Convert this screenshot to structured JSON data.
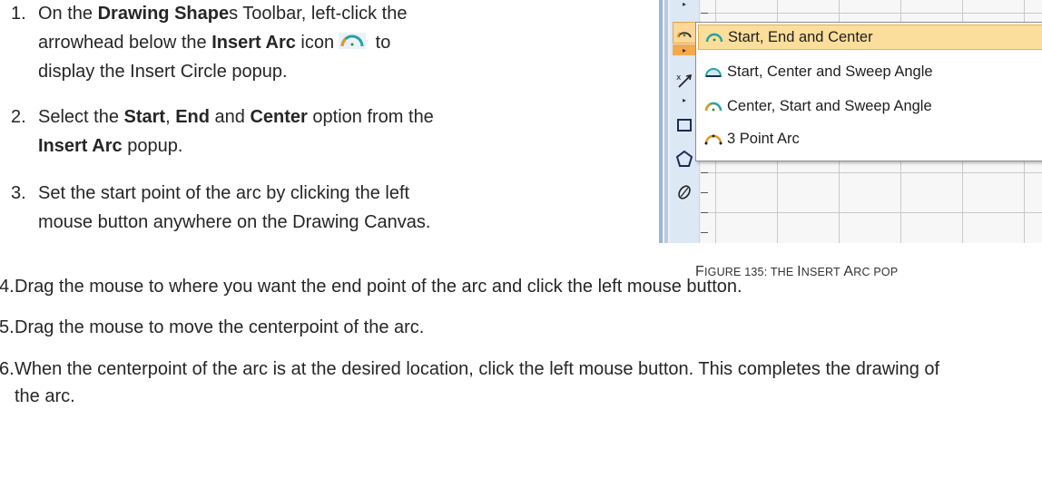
{
  "steps": [
    {
      "number": "1.",
      "lines": [
        [
          "On the ",
          "Drawing Shape",
          "s Toolbar, left-click the"
        ],
        [
          "arrowhead below the ",
          "Insert Arc",
          " icon",
          " to"
        ],
        [
          "display the Insert Circle popup."
        ]
      ]
    },
    {
      "number": "2.",
      "lines": [
        [
          "Select the ",
          "Start",
          ", ",
          "End",
          " and ",
          "Center",
          " option from the"
        ],
        [
          "Insert Arc",
          " popup."
        ]
      ]
    },
    {
      "number": "3.",
      "lines": [
        [
          "Set the start point of the arc by clicking the left"
        ],
        [
          "mouse button anywhere on the Drawing Canvas."
        ]
      ]
    },
    {
      "number": "4.",
      "text": "Drag the mouse to where you want the end point of the arc and click the left mouse button."
    },
    {
      "number": "5.",
      "text": "Drag the mouse to move the centerpoint of the arc."
    },
    {
      "number": "6.",
      "text": "When the centerpoint of the arc is at the desired location, click the left mouse button. This completes the drawing of the arc."
    }
  ],
  "popup": {
    "items": [
      {
        "label": "Start, End and Center",
        "icon": "arc-start-end-center-icon",
        "highlighted": true
      },
      {
        "label": "Start, Center and Sweep Angle",
        "icon": "arc-start-center-sweep-icon",
        "highlighted": false
      },
      {
        "label": "Center, Start and Sweep Angle",
        "icon": "arc-center-start-sweep-icon",
        "highlighted": false
      },
      {
        "label": "3 Point Arc",
        "icon": "arc-3-point-icon",
        "highlighted": false
      }
    ]
  },
  "toolbar": {
    "icons": [
      "insert-arc-icon",
      "dropdown-arrow-icon",
      "insert-line-icon",
      "dropdown-arrow-icon",
      "rectangle-icon",
      "pentagon-icon",
      "freehand-icon"
    ]
  },
  "caption": {
    "figure_number": "F",
    "rest": "IGURE 135: T",
    "he": "HE ",
    "i": "I",
    "nsert": "NSERT ",
    "a": "A",
    "rc": "RC ",
    "pop": "POP"
  },
  "colors": {
    "text": "#262626",
    "highlight": "#fcde9c",
    "highlight_border": "#e4b250",
    "toolbar_bg": "#dde8f5",
    "arc_teal": "#27a3a3",
    "arc_orange": "#e8951e"
  }
}
